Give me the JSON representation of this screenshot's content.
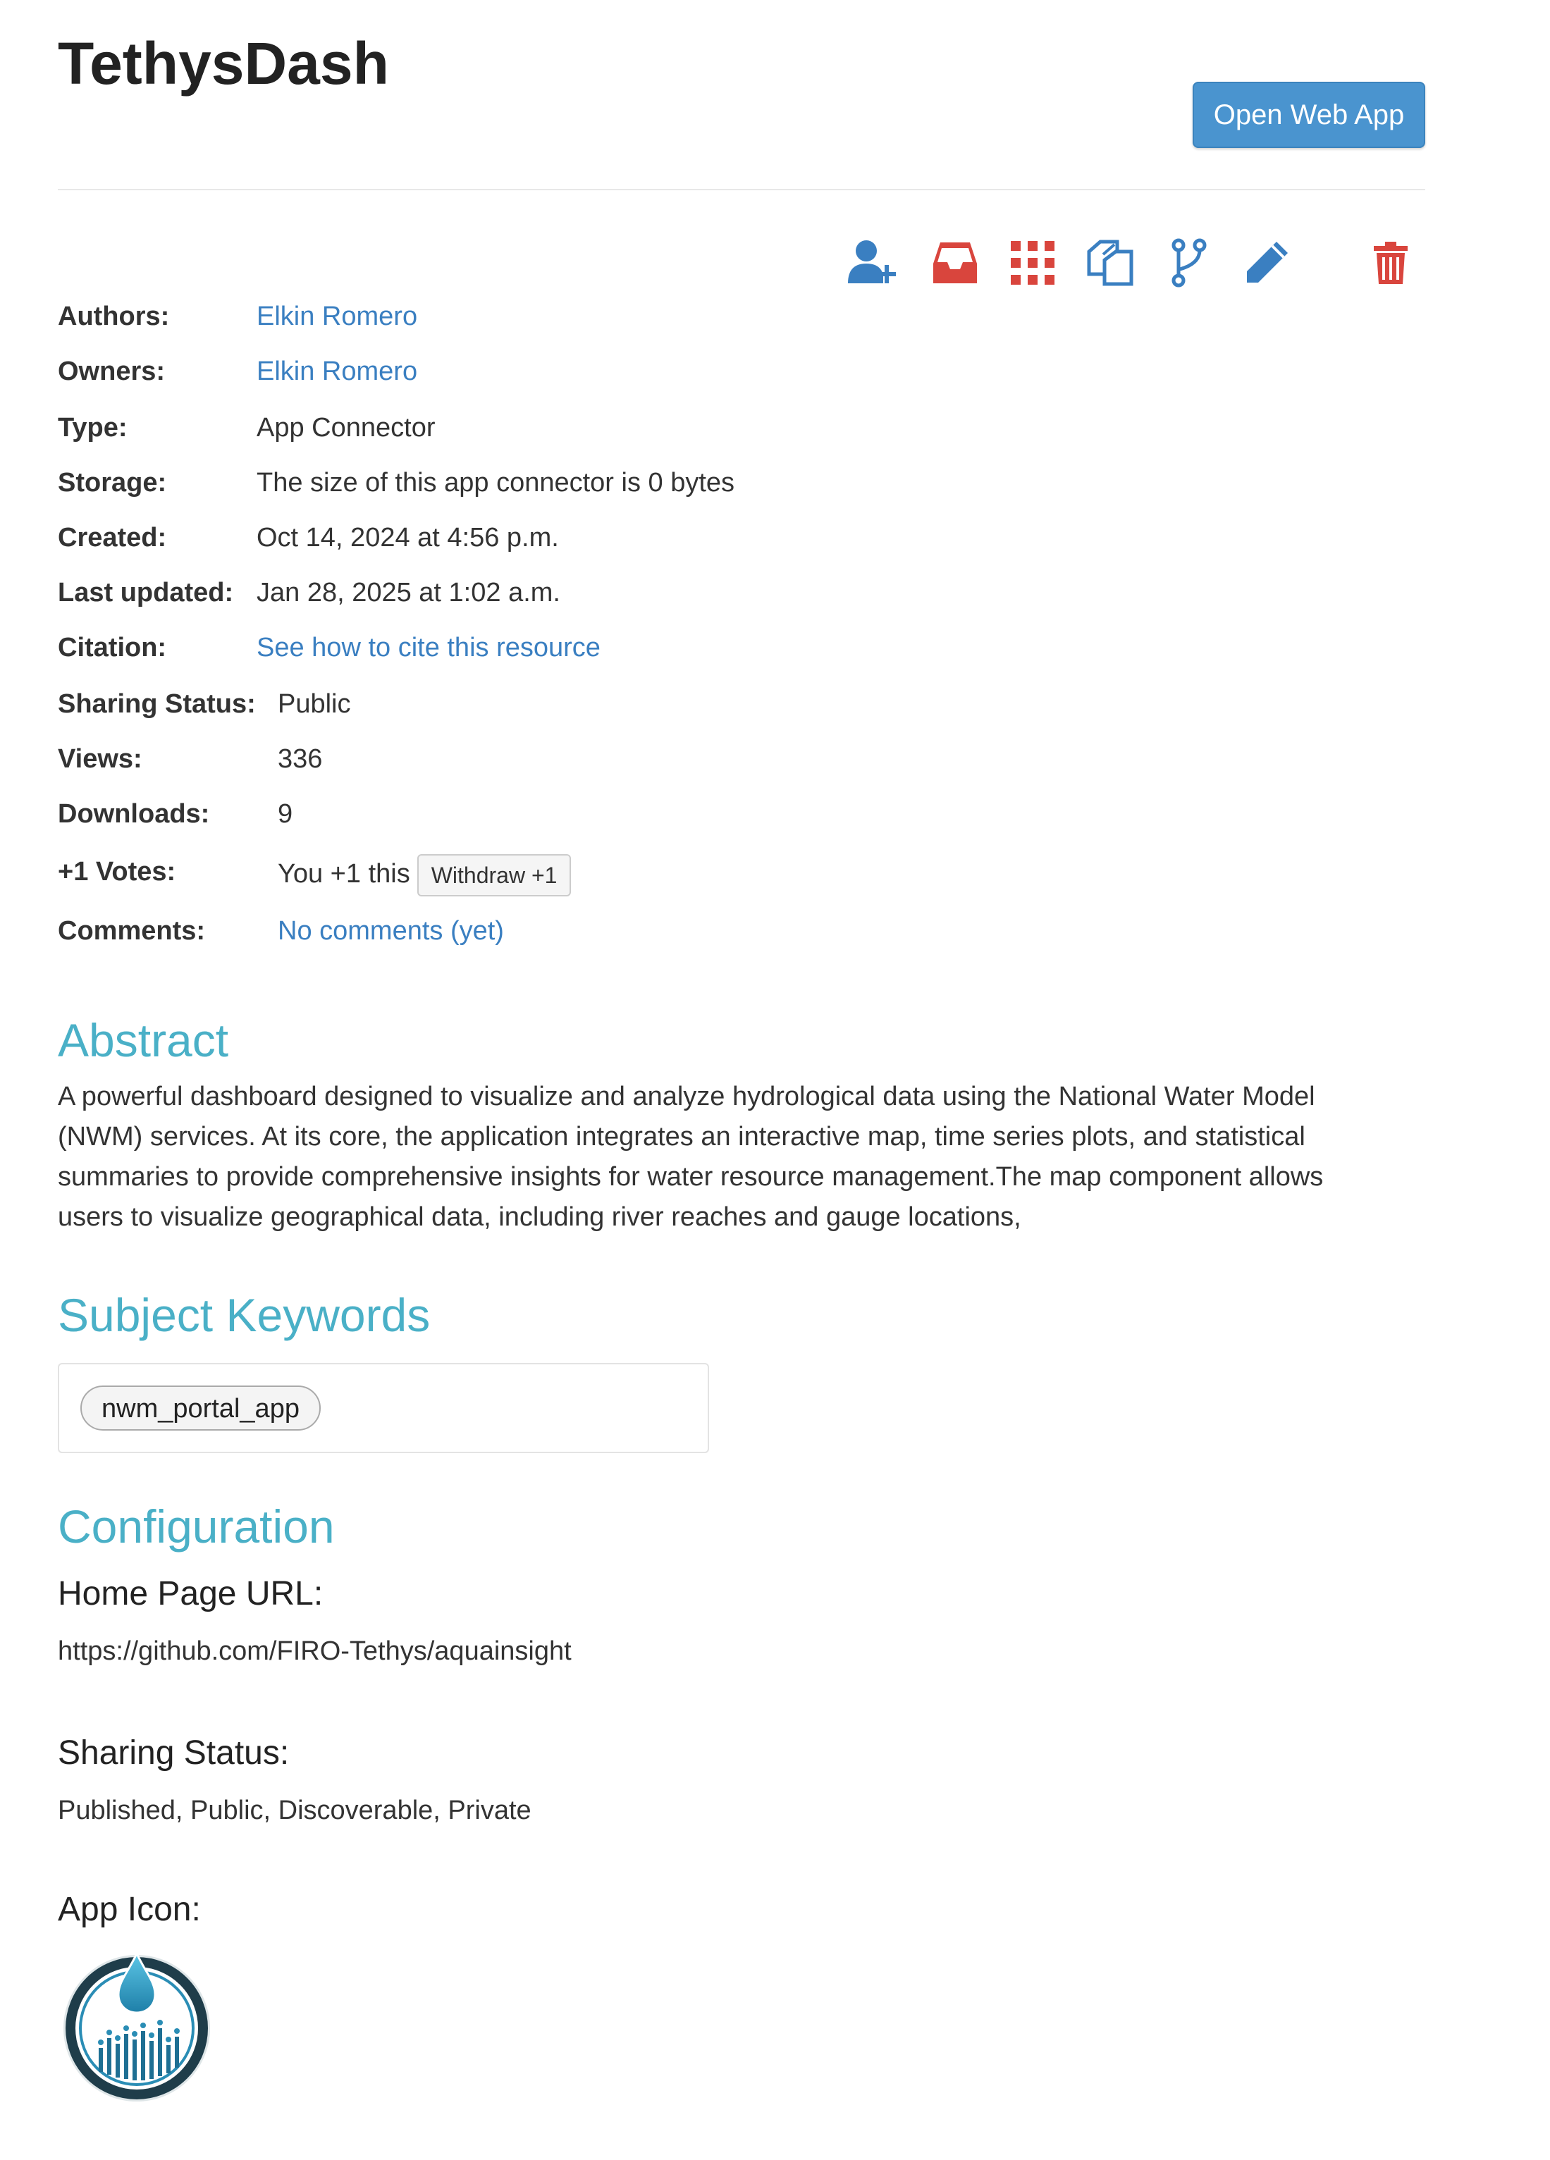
{
  "header": {
    "title": "TethysDash",
    "open_button": "Open Web App"
  },
  "toolbar": {
    "icons": [
      "add-user-icon",
      "inbox-icon",
      "apps-grid-icon",
      "copy-icon",
      "fork-icon",
      "edit-icon",
      "trash-icon"
    ],
    "colors": {
      "blue": "#3a7fc1",
      "red": "#d9453d"
    }
  },
  "meta": {
    "authors": {
      "label": "Authors:",
      "value": "Elkin Romero"
    },
    "owners": {
      "label": "Owners:",
      "value": "Elkin Romero"
    },
    "type": {
      "label": "Type:",
      "value": "App Connector"
    },
    "storage": {
      "label": "Storage:",
      "value": "The size of this app connector is 0 bytes"
    },
    "created": {
      "label": "Created:",
      "value": "Oct 14, 2024 at 4:56 p.m."
    },
    "updated": {
      "label": "Last updated:",
      "value": "Jan 28, 2025 at 1:02 a.m."
    },
    "citation": {
      "label": "Citation:",
      "value": "See how to cite this resource"
    },
    "sharing": {
      "label": "Sharing Status:",
      "value": "Public"
    },
    "views": {
      "label": "Views:",
      "value": "336"
    },
    "downloads": {
      "label": "Downloads:",
      "value": "9"
    },
    "votes": {
      "label": "+1 Votes:",
      "value": "You +1 this",
      "button": "Withdraw +1"
    },
    "comments": {
      "label": "Comments:",
      "value": "No comments (yet)"
    }
  },
  "abstract": {
    "heading": "Abstract",
    "text": "A powerful dashboard designed to visualize and analyze hydrological data using the National Water Model (NWM) services. At its core, the application integrates an interactive map, time series plots, and statistical summaries to provide comprehensive insights for water resource management.The map component allows users to visualize geographical data, including river reaches and gauge locations,"
  },
  "keywords": {
    "heading": "Subject Keywords",
    "items": [
      "nwm_portal_app"
    ]
  },
  "configuration": {
    "heading": "Configuration",
    "home_label": "Home Page URL:",
    "home_url": "https://github.com/FIRO-Tethys/aquainsight",
    "sharing_label": "Sharing Status:",
    "sharing_value": "Published, Public, Discoverable, Private",
    "icon_label": "App Icon:"
  },
  "accent_colors": {
    "link": "#3a7fc1",
    "heading": "#4ab0c7",
    "button": "#4a94cf"
  }
}
